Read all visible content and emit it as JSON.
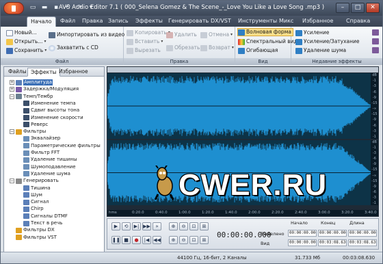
{
  "titlebar": {
    "title": "AVS Audio Editor 7.1  ( 000_Selena Gomez & The Scene_-_Love You Like a Love Song .mp3 )",
    "minimize": "–",
    "maximize": "□",
    "close": "✕"
  },
  "tabs": [
    "Начало",
    "Файл",
    "Правка",
    "Запись",
    "Эффекты",
    "Генерировать",
    "DX/VST",
    "Инструменты",
    "Микс",
    "Избранное",
    "Справка"
  ],
  "ribbon": {
    "file": {
      "label": "Файл",
      "new": "Новый...",
      "open": "Открыть...",
      "save": "Сохранить",
      "import_video": "Импортировать из видео",
      "capture_cd": "Захватить с CD"
    },
    "edit": {
      "label": "Правка",
      "copy": "Копировать",
      "paste": "Вставить",
      "cut": "Вырезать",
      "delete": "Удалить",
      "trim": "Обрезать",
      "undo": "Отмена",
      "redo": "Возврат"
    },
    "view": {
      "label": "Вид",
      "waveform": "Волновая форма",
      "spectral": "Спектральный вид",
      "envelope": "Огибающая"
    },
    "recent": {
      "label": "Недавние эффекты",
      "amplify": "Усиление",
      "fade": "Усиление/Затухание",
      "noise": "Удаление шума"
    }
  },
  "leftpanel": {
    "tabs": [
      "Файлы",
      "Эффекты",
      "Избранное"
    ],
    "tree": [
      {
        "label": "Амплитуда",
        "level": 0,
        "toggle": "+",
        "color": "#5b7fb8"
      },
      {
        "label": "Задержка/Модуляция",
        "level": 0,
        "toggle": "+",
        "color": "#7a5aa8"
      },
      {
        "label": "Темп/Тембр",
        "level": 0,
        "toggle": "−",
        "color": "#6a7f90"
      },
      {
        "label": "Изменение темпа",
        "level": 1,
        "toggle": "",
        "color": "#3c4f6a"
      },
      {
        "label": "Сдвиг высоты тона",
        "level": 1,
        "toggle": "",
        "color": "#3c4f6a"
      },
      {
        "label": "Изменение скорости",
        "level": 1,
        "toggle": "",
        "color": "#3c4f6a"
      },
      {
        "label": "Реверс",
        "level": 1,
        "toggle": "",
        "color": "#3c4f6a"
      },
      {
        "label": "Фильтры",
        "level": 0,
        "toggle": "−",
        "color": "#e0a020"
      },
      {
        "label": "Эквалайзер",
        "level": 1,
        "toggle": "",
        "color": "#6b8fb8"
      },
      {
        "label": "Параметрические фильтры",
        "level": 1,
        "toggle": "",
        "color": "#6b8fb8"
      },
      {
        "label": "Фильтр FFT",
        "level": 1,
        "toggle": "",
        "color": "#6b8fb8"
      },
      {
        "label": "Удаление тишины",
        "level": 1,
        "toggle": "",
        "color": "#6b8fb8"
      },
      {
        "label": "Шумоподавление",
        "level": 1,
        "toggle": "",
        "color": "#6b8fb8"
      },
      {
        "label": "Удаление шума",
        "level": 1,
        "toggle": "",
        "color": "#6b8fb8"
      },
      {
        "label": "Генерировать",
        "level": 0,
        "toggle": "−",
        "color": "#8a8a8a"
      },
      {
        "label": "Тишина",
        "level": 1,
        "toggle": "",
        "color": "#5b7fb8"
      },
      {
        "label": "Шум",
        "level": 1,
        "toggle": "",
        "color": "#5b7fb8"
      },
      {
        "label": "Сигнал",
        "level": 1,
        "toggle": "",
        "color": "#5b7fb8"
      },
      {
        "label": "Chirp",
        "level": 1,
        "toggle": "",
        "color": "#5b7fb8"
      },
      {
        "label": "Сигналы DTMF",
        "level": 1,
        "toggle": "",
        "color": "#5b7fb8"
      },
      {
        "label": "Текст в речь",
        "level": 1,
        "toggle": "",
        "color": "#5b7fb8"
      },
      {
        "label": "Фильтры DX",
        "level": 0,
        "toggle": "",
        "color": "#e0a020"
      },
      {
        "label": "Фильтры VST",
        "level": 0,
        "toggle": "",
        "color": "#e0a020"
      }
    ]
  },
  "wave": {
    "timeline": [
      "hms",
      "0:20.0",
      "0:40.0",
      "1:00.0",
      "1:20.0",
      "1:40.0",
      "2:00.0",
      "2:20.0",
      "2:40.0",
      "3:00.0",
      "3:20.0",
      "3:40.0"
    ],
    "db_top": [
      "dB",
      "-1",
      "-3",
      "-6",
      "-9",
      "-15",
      "-∞",
      "-15",
      "-9",
      "-6",
      "-3",
      "-1"
    ],
    "watermark": "CWER.RU"
  },
  "transport": {
    "timecode": "00:00:00.000",
    "headers": [
      "Начало",
      "Конец",
      "Длина"
    ],
    "rows": [
      {
        "label": "Выделено",
        "values": [
          "00:00:00.000",
          "00:00:00.000",
          "00:00:00.000"
        ]
      },
      {
        "label": "Вид",
        "values": [
          "00:00:00.000",
          "00:03:08.630",
          "00:03:08.630"
        ]
      }
    ]
  },
  "status": {
    "format": "44100 Гц, 16-бит, 2 Каналы",
    "size": "31.733 Мб",
    "duration": "00:03:08.630"
  },
  "colors": {
    "wave": "#1e8fd0",
    "wave_bg": "#0d3347",
    "accent": "#f9df8a"
  }
}
